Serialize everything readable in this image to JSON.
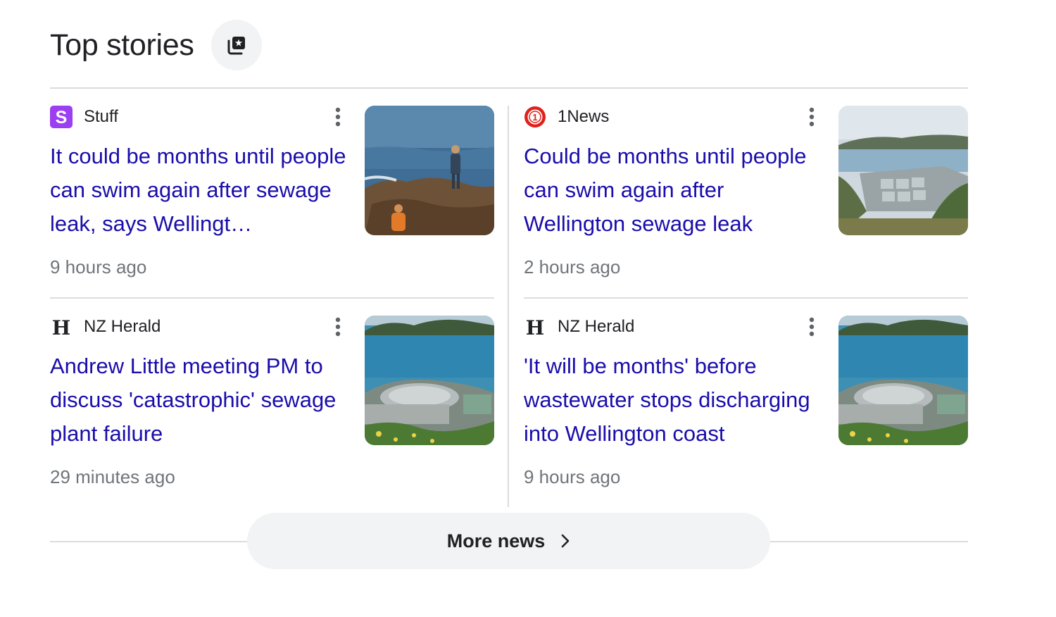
{
  "section": {
    "title": "Top stories",
    "header_icon": "stories-icon"
  },
  "stories": [
    {
      "source": "Stuff",
      "source_icon": "stuff-logo",
      "headline": "It could be months until people can swim again after sewage leak, says Wellingt…",
      "time": "9 hours ago",
      "thumbnail": "rocky-shore-photo"
    },
    {
      "source": "1News",
      "source_icon": "1news-logo",
      "headline": "Could be months until people can swim again after Wellington sewage leak",
      "time": "2 hours ago",
      "thumbnail": "treatment-plant-photo"
    },
    {
      "source": "NZ Herald",
      "source_icon": "nz-herald-logo",
      "headline": "Andrew Little meeting PM to discuss 'catastrophic' sewage plant failure",
      "time": "29 minutes ago",
      "thumbnail": "coastal-plant-photo"
    },
    {
      "source": "NZ Herald",
      "source_icon": "nz-herald-logo",
      "headline": "'It will be months' before wastewater stops discharging into Wellington coast",
      "time": "9 hours ago",
      "thumbnail": "coastal-plant-photo"
    }
  ],
  "more_news": {
    "label": "More news",
    "icon": "chevron-right-icon"
  },
  "colors": {
    "headline": "#1a0dab",
    "meta": "#70757a",
    "divider": "#dadce0",
    "button_bg": "#f1f3f4",
    "stuff_brand": "#9b3ff2",
    "onenews_brand": "#e0201b"
  }
}
